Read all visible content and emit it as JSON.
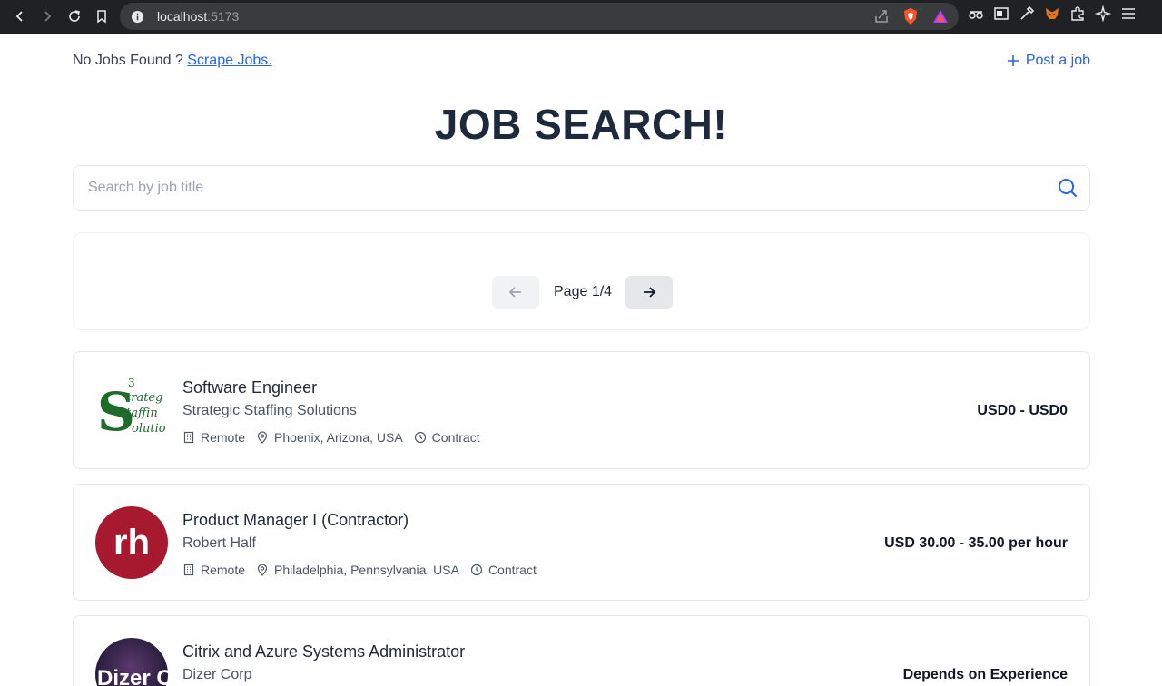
{
  "browser": {
    "url_host": "localhost",
    "url_port": ":5173"
  },
  "top": {
    "no_jobs_text": "No Jobs Found ? ",
    "scrape_link": "Scrape Jobs.",
    "post_job_label": "Post a job"
  },
  "title": "JOB SEARCH!",
  "search": {
    "placeholder": "Search by job title",
    "value": ""
  },
  "pagination": {
    "label": "Page 1/4"
  },
  "jobs": [
    {
      "title": "Software Engineer",
      "company": "Strategic Staffing Solutions",
      "work_type": "Remote",
      "location": "Phoenix, Arizona, USA",
      "employment": "Contract",
      "salary": "USD0 - USD0",
      "logo_text": "Strategic Staffing Solutions"
    },
    {
      "title": "Product Manager I (Contractor)",
      "company": "Robert Half",
      "work_type": "Remote",
      "location": "Philadelphia, Pennsylvania, USA",
      "employment": "Contract",
      "salary": "USD 30.00 - 35.00 per hour",
      "logo_text": "rh"
    },
    {
      "title": "Citrix and Azure Systems Administrator",
      "company": "Dizer Corp",
      "salary": "Depends on Experience",
      "logo_text": "Dizer C"
    }
  ],
  "colors": {
    "accent": "#2563eb",
    "title": "#1e293b",
    "rh_red": "#a6192e"
  }
}
